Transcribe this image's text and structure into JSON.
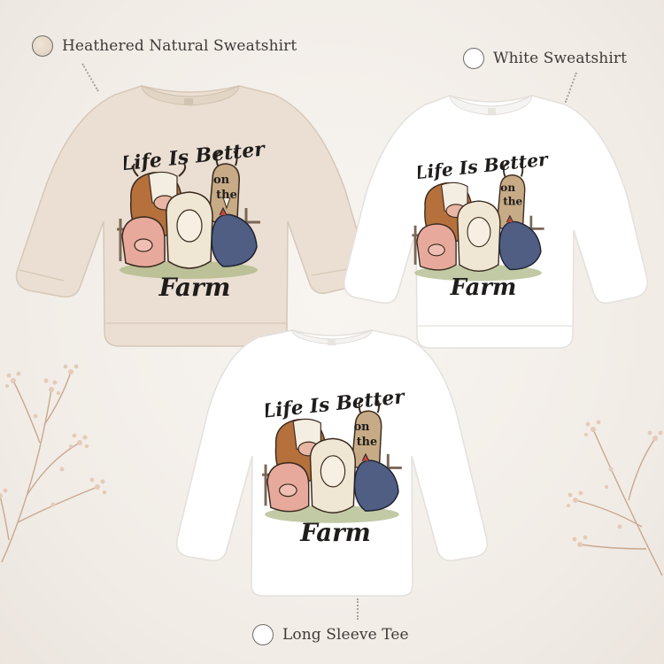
{
  "products": [
    {
      "label": "Heathered Natural Sweatshirt",
      "swatch_color": "#e7dccf",
      "body_color": "#eadfd2"
    },
    {
      "label": "White Sweatshirt",
      "swatch_color": "#ffffff",
      "body_color": "#ffffff"
    },
    {
      "label": "Long Sleeve Tee",
      "swatch_color": "#ffffff",
      "body_color": "#ffffff"
    }
  ],
  "design": {
    "line1": "Life Is Better",
    "line2": "on",
    "line3": "the",
    "line4": "Farm"
  },
  "colors": {
    "background": "#f3efeb",
    "text": "#3e3a37",
    "ink": "#1f1d1c",
    "cow": "#b5703c",
    "pig": "#e7a99c",
    "sheep": "#efe6d3",
    "hen": "#4f5e82",
    "goat": "#c7ab86",
    "sprig": "#d8b9a3"
  },
  "icons": [
    "swatch-circle-icon",
    "cow-icon",
    "goat-icon",
    "sheep-icon",
    "pig-icon",
    "hen-icon",
    "fence-icon",
    "dried-flower-icon"
  ]
}
